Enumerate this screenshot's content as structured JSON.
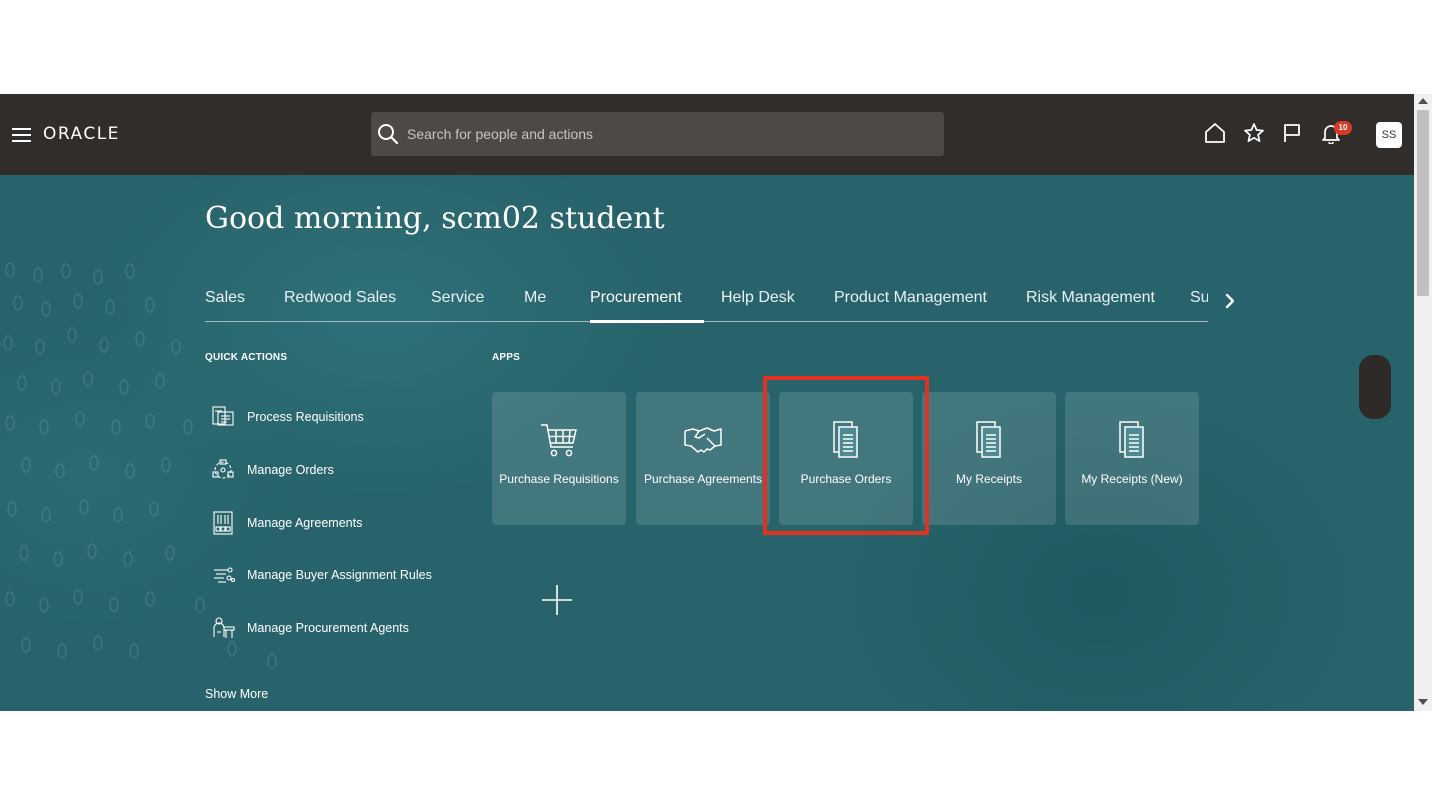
{
  "header": {
    "logo_text": "ORACLE",
    "search": {
      "placeholder": "Search for people and actions"
    },
    "notifications_count": "10",
    "user_initials": "SS"
  },
  "greeting": "Good morning, scm02 student",
  "tabs": [
    {
      "label": "Sales"
    },
    {
      "label": "Redwood Sales"
    },
    {
      "label": "Service"
    },
    {
      "label": "Me"
    },
    {
      "label": "Procurement"
    },
    {
      "label": "Help Desk"
    },
    {
      "label": "Product Management"
    },
    {
      "label": "Risk Management"
    },
    {
      "label": "Su"
    }
  ],
  "active_tab": "Procurement",
  "quick_actions": {
    "title": "QUICK ACTIONS",
    "items": [
      {
        "label": "Process Requisitions",
        "icon": "requisition-icon"
      },
      {
        "label": "Manage Orders",
        "icon": "orders-cycle-icon"
      },
      {
        "label": "Manage Agreements",
        "icon": "agreements-icon"
      },
      {
        "label": "Manage Buyer Assignment Rules",
        "icon": "rules-icon"
      },
      {
        "label": "Manage Procurement Agents",
        "icon": "agent-icon"
      }
    ],
    "show_more": "Show More"
  },
  "apps": {
    "title": "APPS",
    "items": [
      {
        "label": "Purchase Requisitions",
        "icon": "cart-icon"
      },
      {
        "label": "Purchase Agreements",
        "icon": "handshake-icon"
      },
      {
        "label": "Purchase Orders",
        "icon": "document-icon",
        "highlighted": true
      },
      {
        "label": "My Receipts",
        "icon": "document-icon"
      },
      {
        "label": "My Receipts (New)",
        "icon": "document-icon"
      }
    ]
  },
  "colors": {
    "header_bg": "#312d2a",
    "hero_bg": "#28636b",
    "highlight": "#e3311f",
    "badge": "#d63b25"
  }
}
